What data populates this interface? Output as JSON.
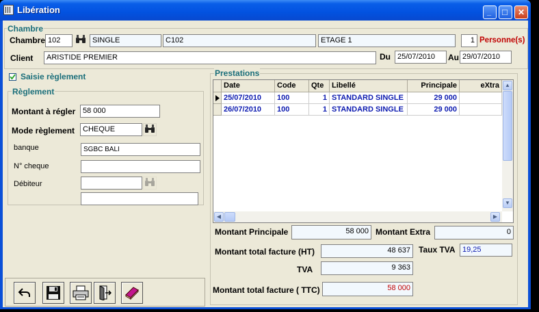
{
  "window": {
    "title": "Libération",
    "minimize_glyph": "_",
    "maximize_glyph": "□",
    "close_glyph": "✕"
  },
  "chambre": {
    "group_title": "Chambre",
    "label": "Chambre",
    "number": "102",
    "type": "SINGLE",
    "code": "C102",
    "etage": "ETAGE 1",
    "personnes_count": "1",
    "personnes_label": "Personne(s)"
  },
  "client": {
    "label": "Client",
    "name": "ARISTIDE PREMIER",
    "du_label": "Du",
    "du_date": "25/07/2010",
    "au_label": "Au",
    "au_date": "29/07/2010"
  },
  "saisie": {
    "checkbox_label": "Saisie règlement",
    "checked": true
  },
  "reglement": {
    "group_title": "Règlement",
    "montant_label": "Montant à régler",
    "montant_value": "58 000",
    "mode_label": "Mode règlement",
    "mode_value": "CHEQUE",
    "banque_label": "banque",
    "banque_value": "SGBC BALI",
    "cheque_label": "N° cheque",
    "cheque_value": "",
    "debiteur_label": "Débiteur",
    "debiteur_value": "",
    "extra_value": ""
  },
  "prestations": {
    "group_title": "Prestations",
    "columns": [
      "Date",
      "Code",
      "Qte",
      "Libellé",
      "Principale",
      "eXtra"
    ],
    "rows": [
      {
        "date": "25/07/2010",
        "code": "100",
        "qte": "1",
        "libelle": "STANDARD SINGLE",
        "principale": "29 000",
        "extra": ""
      },
      {
        "date": "26/07/2010",
        "code": "100",
        "qte": "1",
        "libelle": "STANDARD SINGLE",
        "principale": "29 000",
        "extra": ""
      }
    ]
  },
  "totals": {
    "principale_label": "Montant Principale",
    "principale_value": "58 000",
    "extra_label": "Montant Extra",
    "extra_value": "0",
    "ht_label": "Montant total facture (HT)",
    "ht_value": "48 637",
    "taux_tva_label": "Taux TVA",
    "taux_tva_value": "19,25",
    "tva_label": "TVA",
    "tva_value": "9 363",
    "ttc_label": "Montant total facture ( TTC)",
    "ttc_value": "58 000"
  },
  "icons": {
    "binoculars": "binoculars-icon",
    "undo": "undo-icon",
    "save": "save-icon",
    "print": "printer-icon",
    "exit": "exit-door-icon",
    "book": "book-icon"
  },
  "colors": {
    "group_title": "#1a6e7a",
    "grid_text": "#0d1bb0",
    "personnes": "#c00000",
    "ttc_value": "#c00000"
  }
}
